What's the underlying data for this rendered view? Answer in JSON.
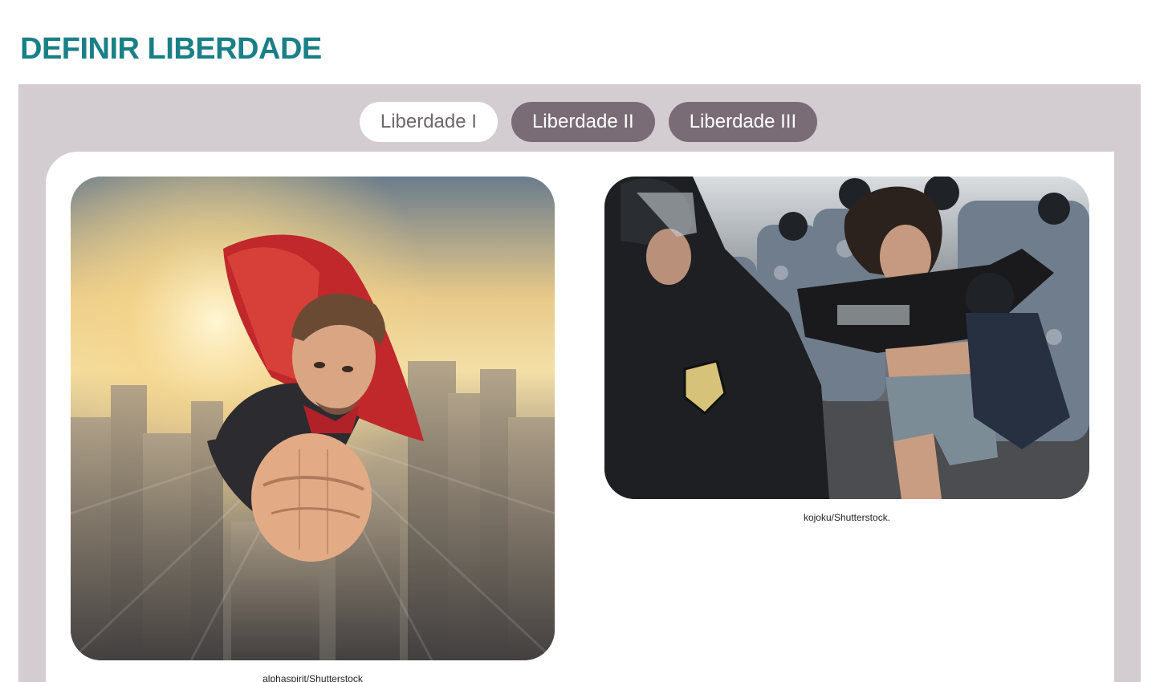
{
  "page": {
    "title": "DEFINIR LIBERDADE"
  },
  "tabs": [
    {
      "label": "Liberdade I",
      "active": true
    },
    {
      "label": "Liberdade II",
      "active": false
    },
    {
      "label": "Liberdade III",
      "active": false
    }
  ],
  "images": [
    {
      "caption": "alphaspirit/Shutterstock",
      "subject": "superhero-flying-over-city"
    },
    {
      "caption": "kojoku/Shutterstock.",
      "subject": "police-arresting-protester"
    }
  ],
  "colors": {
    "title": "#1a7f86",
    "panel": "#d3cdd1",
    "tab_active_bg": "#ffffff",
    "tab_inactive_bg": "#7a6c76"
  }
}
